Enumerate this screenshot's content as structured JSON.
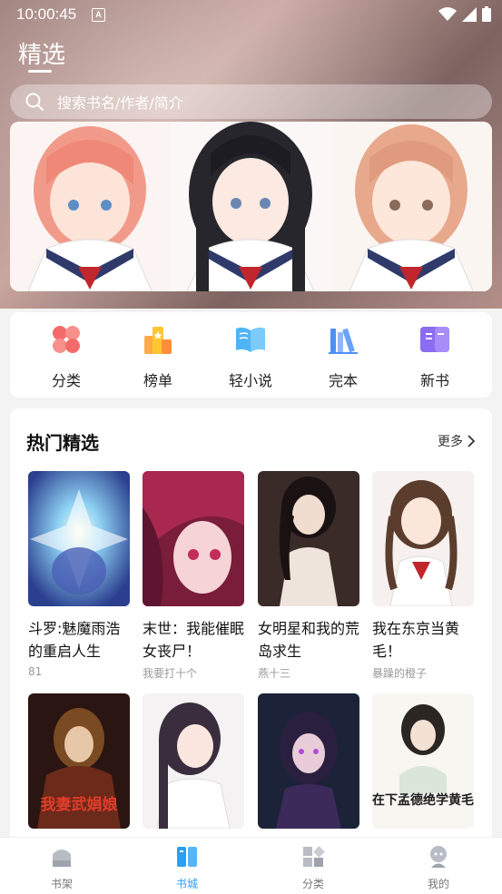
{
  "status": {
    "time": "10:00:45",
    "badge": "A"
  },
  "header": {
    "title": "精选"
  },
  "search": {
    "placeholder": "搜索书名/作者/简介"
  },
  "categories": [
    {
      "label": "分类",
      "icon": "four-petal-icon"
    },
    {
      "label": "榜单",
      "icon": "ranking-icon"
    },
    {
      "label": "轻小说",
      "icon": "open-book-icon"
    },
    {
      "label": "完本",
      "icon": "bookshelf-icon"
    },
    {
      "label": "新书",
      "icon": "new-book-icon"
    }
  ],
  "hot": {
    "title": "热门精选",
    "more": "更多",
    "books": [
      {
        "title": "斗罗:魅魔雨浩的重启人生",
        "author": "81"
      },
      {
        "title": "末世：我能催眠女丧尸！",
        "author": "我要打十个"
      },
      {
        "title": "女明星和我的荒岛求生",
        "author": "燕十三"
      },
      {
        "title": "我在东京当黄毛！",
        "author": "暴躁的橙子"
      },
      {
        "title": "",
        "author": "",
        "cover_text": "我妻武娟娘"
      },
      {
        "title": "",
        "author": ""
      },
      {
        "title": "",
        "author": ""
      },
      {
        "title": "",
        "author": "",
        "cover_text": "在下孟德绝学黄毛"
      }
    ]
  },
  "nav": [
    {
      "label": "书架",
      "icon": "bookshelf-nav-icon",
      "active": false
    },
    {
      "label": "书城",
      "icon": "bookstore-nav-icon",
      "active": true
    },
    {
      "label": "分类",
      "icon": "category-nav-icon",
      "active": false
    },
    {
      "label": "我的",
      "icon": "profile-nav-icon",
      "active": false
    }
  ],
  "colors": {
    "accent": "#2a9ff3",
    "inactive": "#777777"
  }
}
